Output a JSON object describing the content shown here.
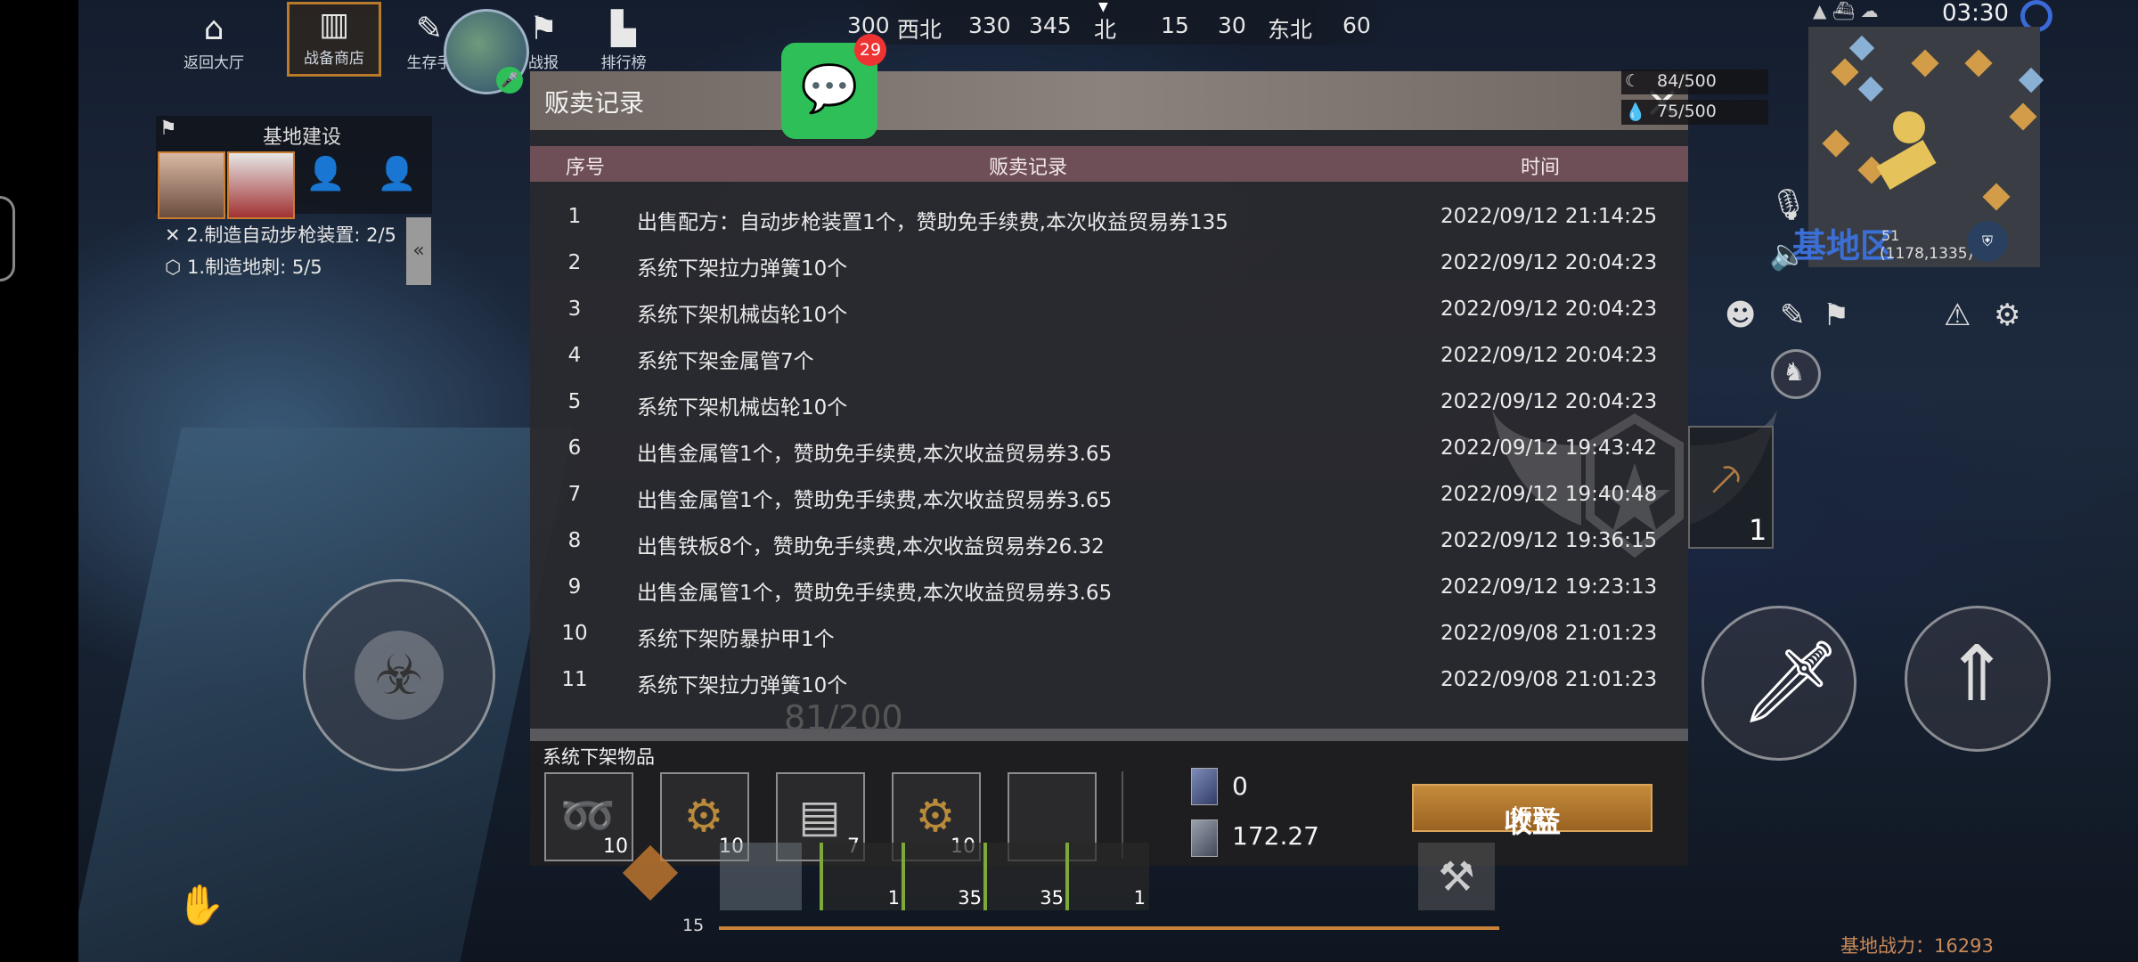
{
  "top_nav": {
    "items": [
      {
        "label": "返回大厅",
        "icon": "home-icon"
      },
      {
        "label": "战备商店",
        "icon": "shop-icon"
      },
      {
        "label": "生存手",
        "icon": "book-icon"
      },
      {
        "label": "战报",
        "icon": "flag-icon"
      },
      {
        "label": "排行榜",
        "icon": "ranking-icon"
      }
    ]
  },
  "compass": {
    "ticks": [
      "300",
      "西北",
      "330",
      "345",
      "北",
      "15",
      "30",
      "东北",
      "60"
    ]
  },
  "clock": "03:30",
  "notification": {
    "badge": "29"
  },
  "base_panel": {
    "title": "基地建设",
    "tasks": [
      "2.制造自动步枪装置: 2/5",
      "1.制造地刺: 5/5"
    ]
  },
  "dialog": {
    "title": "贩卖记录",
    "columns": {
      "index": "序号",
      "record": "贩卖记录",
      "time": "时间"
    },
    "rows": [
      {
        "index": "1",
        "record": "出售配方：自动步枪装置1个，赞助免手续费,本次收益贸易券135",
        "time": "2022/09/12 21:14:25"
      },
      {
        "index": "2",
        "record": "系统下架拉力弹簧10个",
        "time": "2022/09/12 20:04:23"
      },
      {
        "index": "3",
        "record": "系统下架机械齿轮10个",
        "time": "2022/09/12 20:04:23"
      },
      {
        "index": "4",
        "record": "系统下架金属管7个",
        "time": "2022/09/12 20:04:23"
      },
      {
        "index": "5",
        "record": "系统下架机械齿轮10个",
        "time": "2022/09/12 20:04:23"
      },
      {
        "index": "6",
        "record": "出售金属管1个，赞助免手续费,本次收益贸易券3.65",
        "time": "2022/09/12 19:43:42"
      },
      {
        "index": "7",
        "record": "出售金属管1个，赞助免手续费,本次收益贸易券3.65",
        "time": "2022/09/12 19:40:48"
      },
      {
        "index": "8",
        "record": "出售铁板8个，赞助免手续费,本次收益贸易券26.32",
        "time": "2022/09/12 19:36:15"
      },
      {
        "index": "9",
        "record": "出售金属管1个，赞助免手续费,本次收益贸易券3.65",
        "time": "2022/09/12 19:23:13"
      },
      {
        "index": "10",
        "record": "系统下架防暴护甲1个",
        "time": "2022/09/08 21:01:23"
      },
      {
        "index": "11",
        "record": "系统下架拉力弹簧10个",
        "time": "2022/09/08 21:01:23"
      }
    ],
    "delisted_label": "系统下架物品",
    "delisted_items": [
      {
        "icon": "spring-icon",
        "count": "10"
      },
      {
        "icon": "gear-icon",
        "count": "10"
      },
      {
        "icon": "metal-pipe-icon",
        "count": "7"
      },
      {
        "icon": "gear-icon",
        "count": "10"
      },
      {
        "icon": "empty-slot",
        "count": ""
      }
    ],
    "currency_1": "0",
    "currency_2": "172.27",
    "claim_button": {
      "prefix": "领取",
      "main": "收益"
    }
  },
  "resources": {
    "top": "84/500",
    "bottom": "75/500"
  },
  "minimap": {
    "label": "基地区",
    "coords": "(1178,1335)",
    "level": "51"
  },
  "weapon_count": "1",
  "base_power": "基地战力：16293",
  "bottom_bar": {
    "level": "15",
    "bg_counter": "81/200",
    "slots": [
      "1",
      "35",
      "35",
      "1"
    ]
  },
  "colors": {
    "header_row": "#6e4f58",
    "claim_button": "#b0752e",
    "notice": "#2fbf59"
  }
}
